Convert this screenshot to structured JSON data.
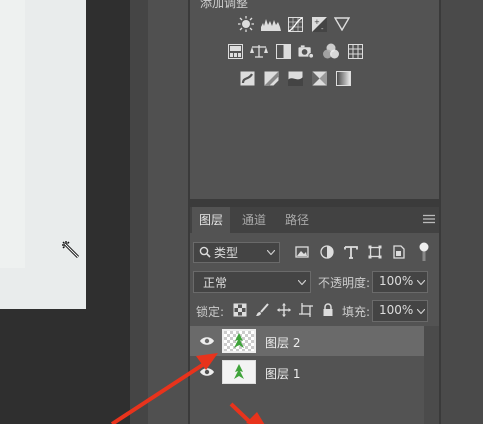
{
  "adjustments": {
    "title": "添加调整",
    "row1": [
      "brightness-contrast-icon",
      "levels-icon",
      "curves-icon",
      "exposure-icon",
      "vibrance-icon"
    ],
    "row2": [
      "hue-saturation-icon",
      "color-balance-icon",
      "black-white-icon",
      "photo-filter-icon",
      "channel-mixer-icon",
      "color-lookup-icon"
    ],
    "row3": [
      "invert-icon",
      "posterize-icon",
      "threshold-icon",
      "selective-color-icon",
      "gradient-map-icon"
    ]
  },
  "layers_panel": {
    "tabs": [
      {
        "label": "图层"
      },
      {
        "label": "通道"
      },
      {
        "label": "路径"
      }
    ],
    "filter": {
      "label": "类型"
    },
    "blend_mode": "正常",
    "opacity_label": "不透明度:",
    "opacity_value": "100%",
    "lock_label": "锁定:",
    "fill_label": "填充:",
    "fill_value": "100%",
    "layers": [
      {
        "name": "图层 2",
        "selected": true
      },
      {
        "name": "图层 1",
        "selected": false
      }
    ]
  },
  "colors": {
    "accent_arrow": "#e8331c",
    "leaf": "#3fa33a"
  }
}
